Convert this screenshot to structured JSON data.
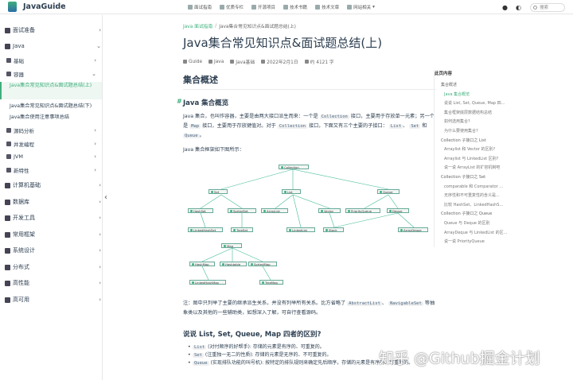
{
  "site": {
    "title": "JavaGuide"
  },
  "nav": {
    "links": [
      "面试指南",
      "优质专栏",
      "开源项目",
      "技术书籍",
      "技术文章",
      "网站相关"
    ],
    "search_placeholder": "搜索",
    "icons": [
      "github-icon",
      "theme-toggle-icon"
    ]
  },
  "sidebar": {
    "items": [
      {
        "label": "面试准备"
      },
      {
        "label": "Java"
      },
      {
        "label": "基础"
      },
      {
        "label": "容器"
      }
    ],
    "container_children": [
      "Java集合常见知识点&面试题总结(上)",
      "Java集合常见知识点&面试题总结(下)",
      "Java集合使用注意事项总结"
    ],
    "java_rest": [
      "源码分析",
      "并发编程",
      "JVM",
      "新特性"
    ],
    "bottom_items": [
      "计算机基础",
      "数据库",
      "开发工具",
      "常用框架",
      "系统设计",
      "分布式",
      "高性能",
      "高可用"
    ]
  },
  "main": {
    "breadcrumb": [
      "Java 面试指南",
      "Java集合常见知识点&面试题总结(上)"
    ],
    "title": "Java集合常见知识点&面试题总结(上)",
    "meta": {
      "author": "Guide",
      "category": "Java",
      "tag": "Java基础",
      "date": "2022年2月1日",
      "reading": "约 4121 字"
    },
    "h2": "集合概述",
    "h3": "Java 集合概览",
    "para1_a": "Java 集合，也叫作容器，主要是由两大接口派生而来：一个是",
    "para1_b": "接口，主要用于存放单一元素；另一个是",
    "para1_c": "接口，主要用于存放键值对。对于",
    "para1_d": "接口，下面又有三个主要的子接口：",
    "para1_e": "和",
    "codes": {
      "collection": "Collection",
      "map": "Map",
      "list": "List",
      "set": "Set",
      "queue": "Queue"
    },
    "para2": "Java 集合框架如下图所示：",
    "note_a": "注：图中只列举了主要的继承派生关系，并没有列举所有关系。比方省略了",
    "note_b": "等抽象类以及其他的一些辅助类，如想深入了解，可自行查看源码。",
    "note_codes": [
      "AbstractList",
      "NavigableSet"
    ],
    "h3b": "说说 List, Set, Queue, Map 四者的区别?",
    "bullets": [
      {
        "code": "List",
        "text": "(对付顺序的好帮手): 存储的元素是有序的、可重复的。"
      },
      {
        "code": "Set",
        "text": "(注重独一无二的性质): 存储的元素是无序的、不可重复的。"
      },
      {
        "code": "Queue",
        "text": "(实现排队功能的叫号机): 按特定的排队规则来确定先后顺序，存储的元素是有序的、可重复的。"
      }
    ]
  },
  "diagram": {
    "top": "Collection",
    "level1": [
      "Set",
      "List",
      "Queue"
    ],
    "level2": [
      "HashSet",
      "SortedSet",
      "ArrayList",
      "Vector",
      "PriorityQueue",
      "Deque"
    ],
    "level3": [
      "LinkedHashSet",
      "TreeSet",
      "LinkedList",
      "Stack",
      "ArrayDeque"
    ],
    "map_top": "Map",
    "map_level1": [
      "HashMap",
      "Hashtable",
      "SortedMap"
    ],
    "map_level2": [
      "LinkedHashMap",
      "TreeMap"
    ]
  },
  "toc": {
    "title": "此页内容",
    "items": [
      {
        "label": "集合概述",
        "level": 2
      },
      {
        "label": "Java 集合概览",
        "level": 3
      },
      {
        "label": "说说 List, Set, Queue, Map 四...",
        "level": 3
      },
      {
        "label": "集合框架底层数据结构总结",
        "level": 3
      },
      {
        "label": "如何选用集合?",
        "level": 3
      },
      {
        "label": "为什么要使用集合?",
        "level": 3
      },
      {
        "label": "Collection 子接口之 List",
        "level": 2
      },
      {
        "label": "Arraylist 和 Vector 的区别?",
        "level": 3
      },
      {
        "label": "Arraylist 与 LinkedList 区别?",
        "level": 3
      },
      {
        "label": "说一说 ArrayList 的扩容机制吧",
        "level": 3
      },
      {
        "label": "Collection 子接口之 Set",
        "level": 2
      },
      {
        "label": "comparable 和 Comparator ...",
        "level": 3
      },
      {
        "label": "无序性和不可重复性的含义是...",
        "level": 3
      },
      {
        "label": "比较 HashSet、LinkedHashS...",
        "level": 3
      },
      {
        "label": "Collection 子接口之 Queue",
        "level": 2
      },
      {
        "label": "Queue 与 Deque 的区别",
        "level": 3
      },
      {
        "label": "ArrayDeque 与 LinkedList 的区...",
        "level": 3
      },
      {
        "label": "说一说 PriorityQueue",
        "level": 3
      }
    ]
  },
  "watermark": "知乎 @Github掘金计划",
  "colors": {
    "accent": "#3eaf7c",
    "text": "#2c3e50"
  }
}
